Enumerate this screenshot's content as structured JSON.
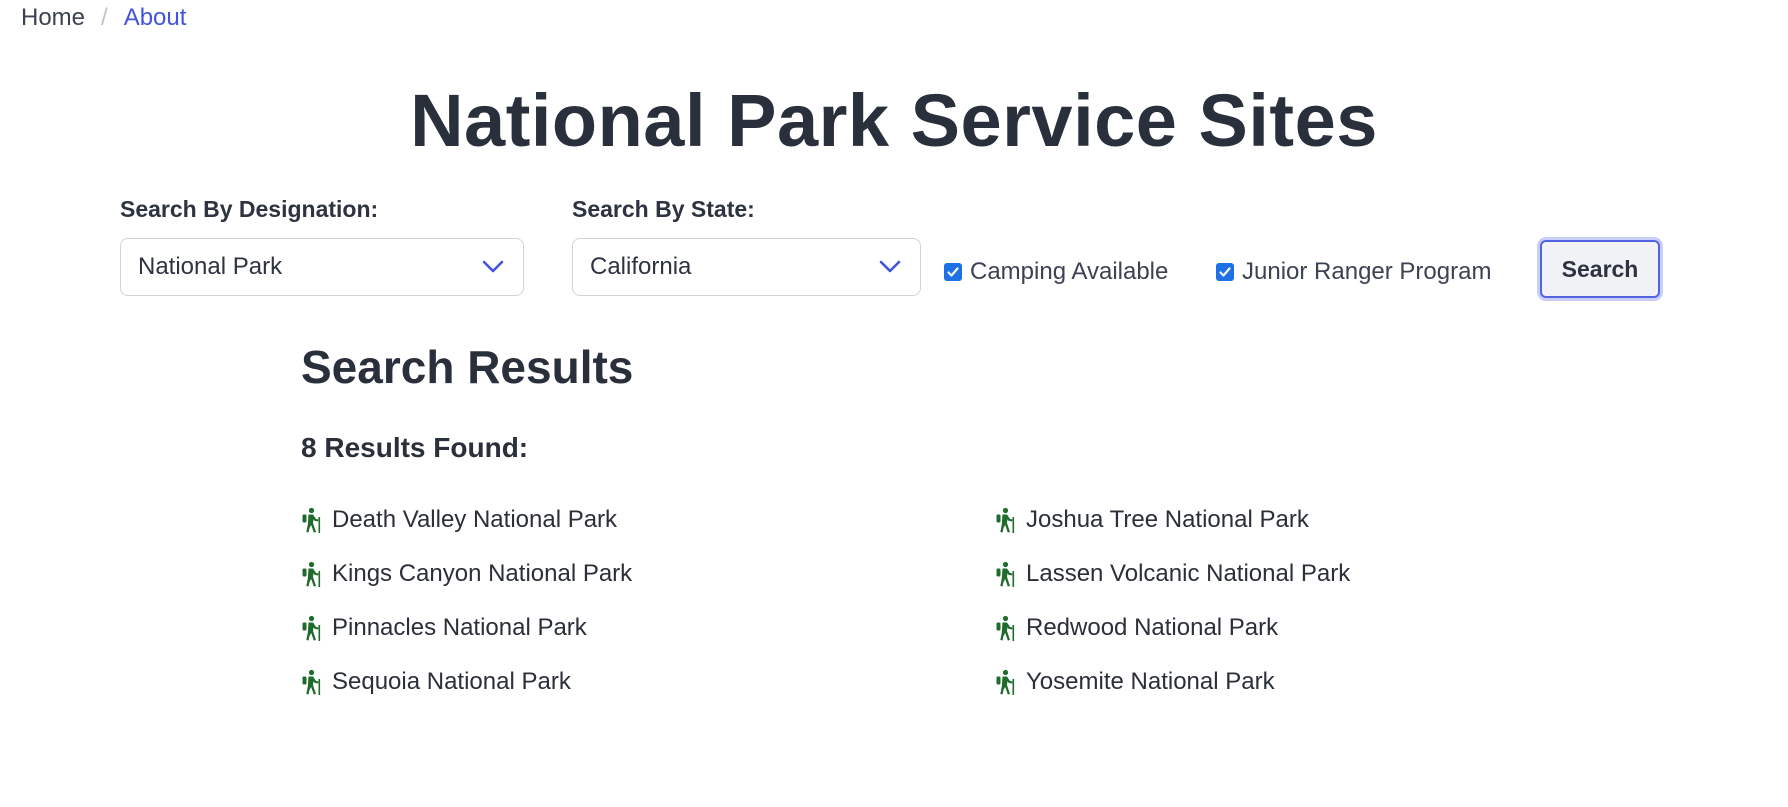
{
  "breadcrumb": {
    "home": "Home",
    "separator": "/",
    "current": "About"
  },
  "page": {
    "title": "National Park Service Sites"
  },
  "filters": {
    "designation": {
      "label": "Search By Designation:",
      "selected": "National Park"
    },
    "state": {
      "label": "Search By State:",
      "selected": "California"
    },
    "camping": {
      "label": "Camping Available",
      "checked": true
    },
    "junior_ranger": {
      "label": "Junior Ranger Program",
      "checked": true
    },
    "search_button": "Search"
  },
  "results": {
    "title": "Search Results",
    "count_text": "8 Results Found:",
    "items": [
      {
        "name": "Death Valley National Park",
        "icon": "hiker-icon"
      },
      {
        "name": "Joshua Tree National Park",
        "icon": "hiker-icon"
      },
      {
        "name": "Kings Canyon National Park",
        "icon": "hiker-icon"
      },
      {
        "name": "Lassen Volcanic National Park",
        "icon": "hiker-icon"
      },
      {
        "name": "Pinnacles National Park",
        "icon": "hiker-icon"
      },
      {
        "name": "Redwood National Park",
        "icon": "hiker-icon"
      },
      {
        "name": "Sequoia National Park",
        "icon": "hiker-icon"
      },
      {
        "name": "Yosemite National Park",
        "icon": "hiker-icon"
      }
    ]
  },
  "colors": {
    "accent": "#4353e0",
    "icon": "#1e6b2b",
    "checkbox": "#1f6fe5",
    "text": "#2d3340"
  }
}
